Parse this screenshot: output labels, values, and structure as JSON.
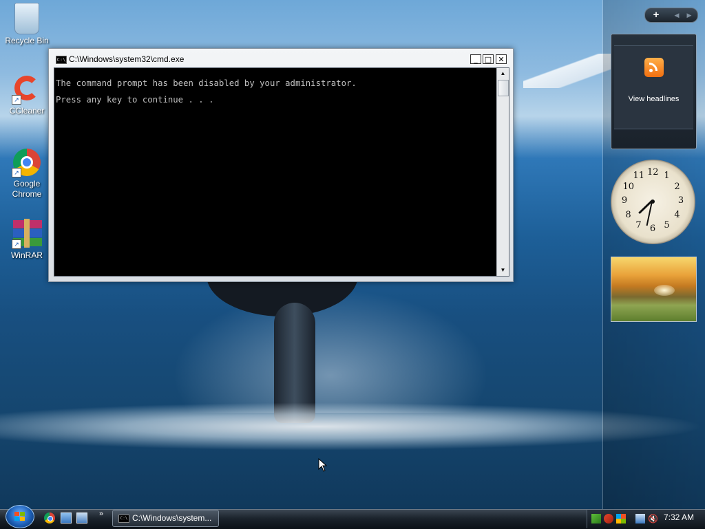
{
  "desktop": {
    "icons": [
      {
        "label": "Recycle Bin"
      },
      {
        "label": "CCleaner"
      },
      {
        "label": "Google Chrome"
      },
      {
        "label": "WinRAR"
      }
    ]
  },
  "cmd_window": {
    "title": "C:\\Windows\\system32\\cmd.exe",
    "icon_text": "C:\\",
    "line1": "The command prompt has been disabled by your administrator.",
    "line2": "Press any key to continue . . .",
    "minimize": "_",
    "maximize": "□",
    "close": "✕"
  },
  "sidebar": {
    "add_label": "+",
    "feed_label": "View headlines",
    "clock_numbers": [
      "12",
      "1",
      "2",
      "3",
      "4",
      "5",
      "6",
      "7",
      "8",
      "9",
      "10",
      "11"
    ],
    "clock_time": {
      "hour": 7,
      "minute": 32
    }
  },
  "taskbar": {
    "more_label": "»",
    "task_label": "C:\\Windows\\system...",
    "time": "7:32 AM"
  },
  "colors": {
    "cmd_background": "#000000",
    "cmd_text": "#c0c0c0",
    "accent": "#1c5fb7"
  }
}
